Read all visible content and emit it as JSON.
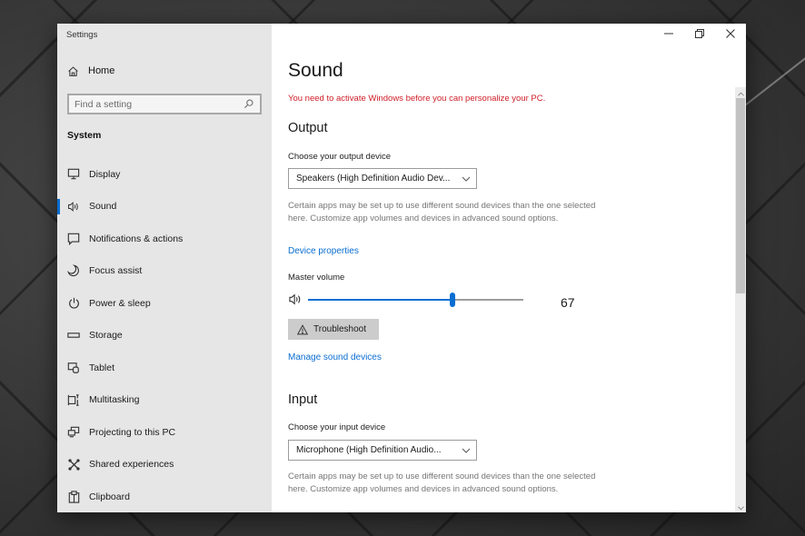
{
  "window": {
    "title": "Settings",
    "controls": {
      "minimize": "minimize-icon",
      "restore": "restore-icon",
      "close": "close-icon"
    }
  },
  "sidebar": {
    "home_label": "Home",
    "search_placeholder": "Find a setting",
    "section_label": "System",
    "items": [
      {
        "label": "Display",
        "icon": "display-icon",
        "active": false
      },
      {
        "label": "Sound",
        "icon": "speaker-icon",
        "active": true
      },
      {
        "label": "Notifications & actions",
        "icon": "notification-icon",
        "active": false
      },
      {
        "label": "Focus assist",
        "icon": "moon-icon",
        "active": false
      },
      {
        "label": "Power & sleep",
        "icon": "power-icon",
        "active": false
      },
      {
        "label": "Storage",
        "icon": "storage-icon",
        "active": false
      },
      {
        "label": "Tablet",
        "icon": "tablet-icon",
        "active": false
      },
      {
        "label": "Multitasking",
        "icon": "multitasking-icon",
        "active": false
      },
      {
        "label": "Projecting to this PC",
        "icon": "projecting-icon",
        "active": false
      },
      {
        "label": "Shared experiences",
        "icon": "shared-experiences-icon",
        "active": false
      },
      {
        "label": "Clipboard",
        "icon": "clipboard-icon",
        "active": false
      }
    ]
  },
  "main": {
    "title": "Sound",
    "activation_warning": "You need to activate Windows before you can personalize your PC.",
    "output": {
      "heading": "Output",
      "device_label": "Choose your output device",
      "device_selected": "Speakers (High Definition Audio Dev...",
      "description": "Certain apps may be set up to use different sound devices than the one selected here. Customize app volumes and devices in advanced sound options.",
      "device_properties_link": "Device properties",
      "master_volume_label": "Master volume",
      "volume_value": "67",
      "volume_fraction": 0.67,
      "troubleshoot_label": "Troubleshoot",
      "manage_devices_link": "Manage sound devices"
    },
    "input": {
      "heading": "Input",
      "device_label": "Choose your input device",
      "device_selected": "Microphone (High Definition Audio...",
      "description": "Certain apps may be set up to use different sound devices than the one selected here. Customize app volumes and devices in advanced sound options."
    },
    "colors": {
      "accent": "#0a6ed1",
      "warning": "#d0202a"
    }
  }
}
